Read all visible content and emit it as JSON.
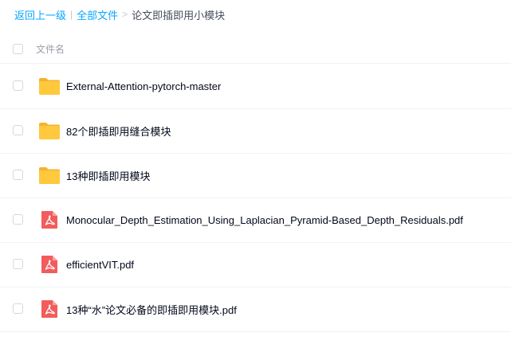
{
  "breadcrumb": {
    "back": "返回上一级",
    "all_files": "全部文件",
    "separator_1": "|",
    "separator_2": ">",
    "current": "论文即插即用小模块"
  },
  "header": {
    "column_name": "文件名"
  },
  "files": [
    {
      "name": "External-Attention-pytorch-master",
      "icon": "folder-icon"
    },
    {
      "name": "82个即插即用缝合模块",
      "icon": "folder-icon"
    },
    {
      "name": "13种即插即用模块",
      "icon": "folder-icon"
    },
    {
      "name": "Monocular_Depth_Estimation_Using_Laplacian_Pyramid-Based_Depth_Residuals.pdf",
      "icon": "pdf-icon"
    },
    {
      "name": "efficientVIT.pdf",
      "icon": "pdf-icon"
    },
    {
      "name": "13种“水”论文必备的即插即用模块.pdf",
      "icon": "pdf-icon"
    }
  ],
  "colors": {
    "accent": "#06a7ff",
    "folder": "#ffc53d",
    "pdf": "#f25c5c"
  }
}
